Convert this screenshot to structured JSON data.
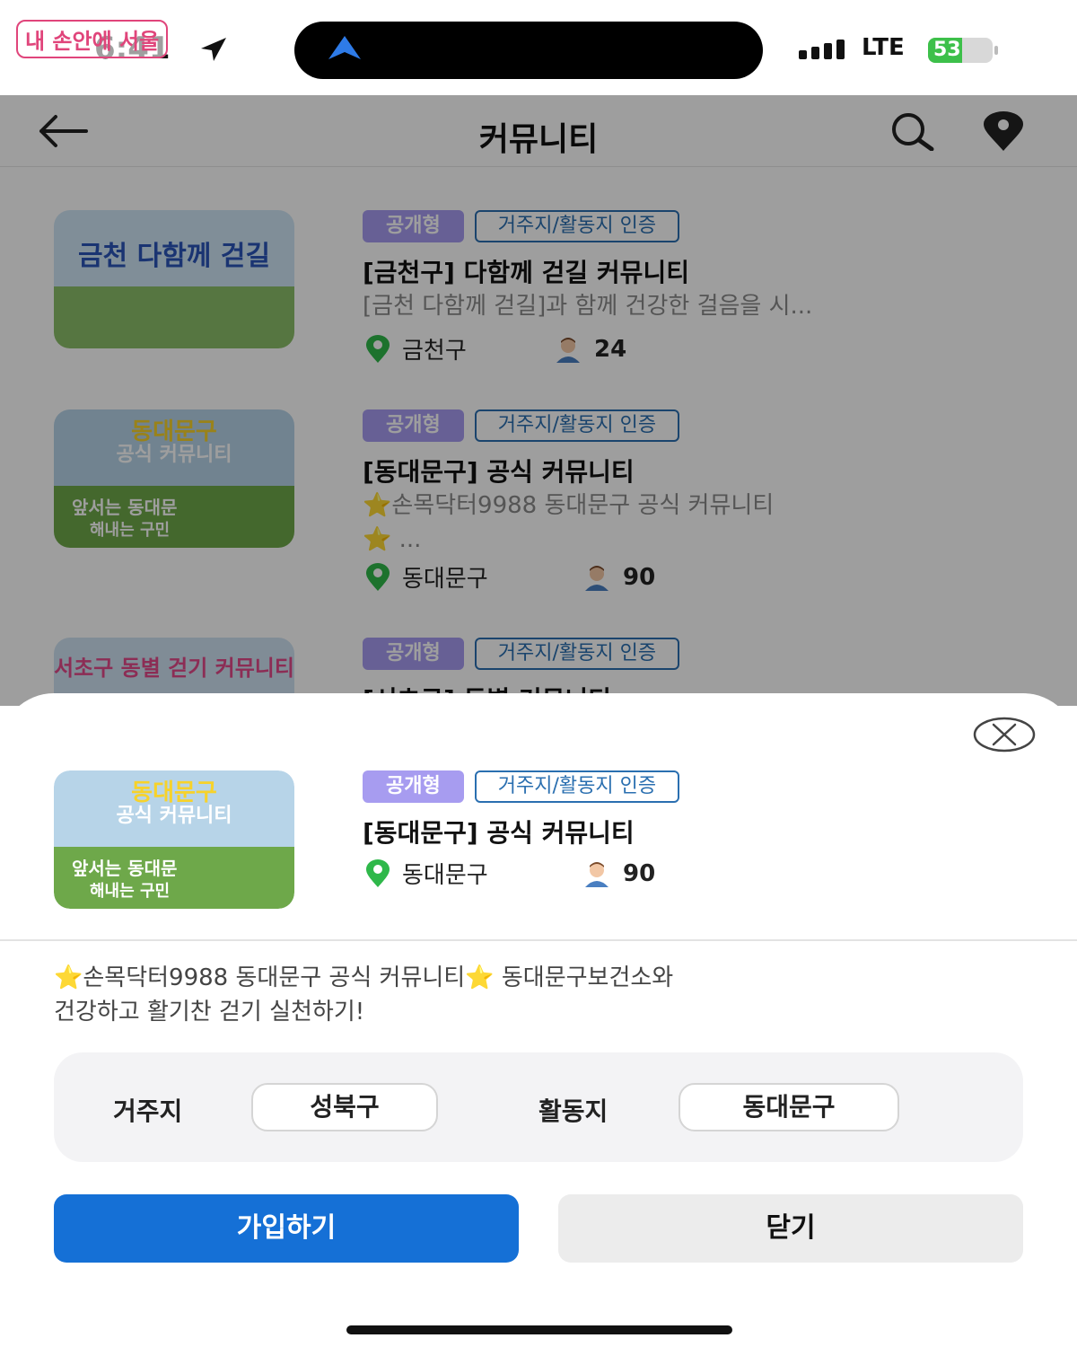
{
  "watermark": "내 손안에 서울",
  "status_bar": {
    "time": "6:41",
    "network": "LTE",
    "battery": "53",
    "battery_level": 0.53
  },
  "app_bar": {
    "title": "커뮤니티",
    "icons": [
      "back-arrow-icon",
      "search-icon",
      "map-pin-icon"
    ]
  },
  "list": [
    {
      "badge_public": "공개형",
      "badge_verify": "거주지/활동지 인증",
      "title": "[금천구] 다함께 걷길 커뮤니티",
      "description": "[금천 다함께 걷길]과 함께 건강한 걸음을 시...",
      "location": "금천구",
      "members": "24",
      "thumb_text": "금천 다함께 걷길"
    },
    {
      "badge_public": "공개형",
      "badge_verify": "거주지/활동지 인증",
      "title": "[동대문구] 공식 커뮤니티",
      "description_star1": "⭐",
      "description": "손목닥터9988 동대문구 공식 커뮤니티",
      "description_star2": "⭐",
      "description_more": " ...",
      "location": "동대문구",
      "members": "90",
      "thumb_text_1": "동대문구",
      "thumb_text_2": "공식 커뮤니티",
      "thumb_text_3": "앞서는 동대문",
      "thumb_text_4": "해내는 구민"
    },
    {
      "badge_public": "공개형",
      "badge_verify": "거주지/활동지 인증",
      "title": "[서초구] 동별 커뮤니티",
      "thumb_text": "서초구 동별 걷기 커뮤니티"
    }
  ],
  "sheet": {
    "badge_public": "공개형",
    "badge_verify": "거주지/활동지 인증",
    "title": "[동대문구] 공식 커뮤니티",
    "location": "동대문구",
    "members": "90",
    "thumb_text_1": "동대문구",
    "thumb_text_2": "공식 커뮤니티",
    "thumb_text_3": "앞서는 동대문",
    "thumb_text_4": "해내는 구민",
    "desc_star": "⭐",
    "description_line1": "손목닥터9988 동대문구 공식 커뮤니티",
    "description_line1b": "  동대문구보건소와",
    "description_line2": "건강하고 활기찬 걷기 실천하기!",
    "residence_label": "거주지",
    "residence_value": "성북구",
    "activity_label": "활동지",
    "activity_value": "동대문구",
    "join_label": "가입하기",
    "close_label": "닫기"
  }
}
